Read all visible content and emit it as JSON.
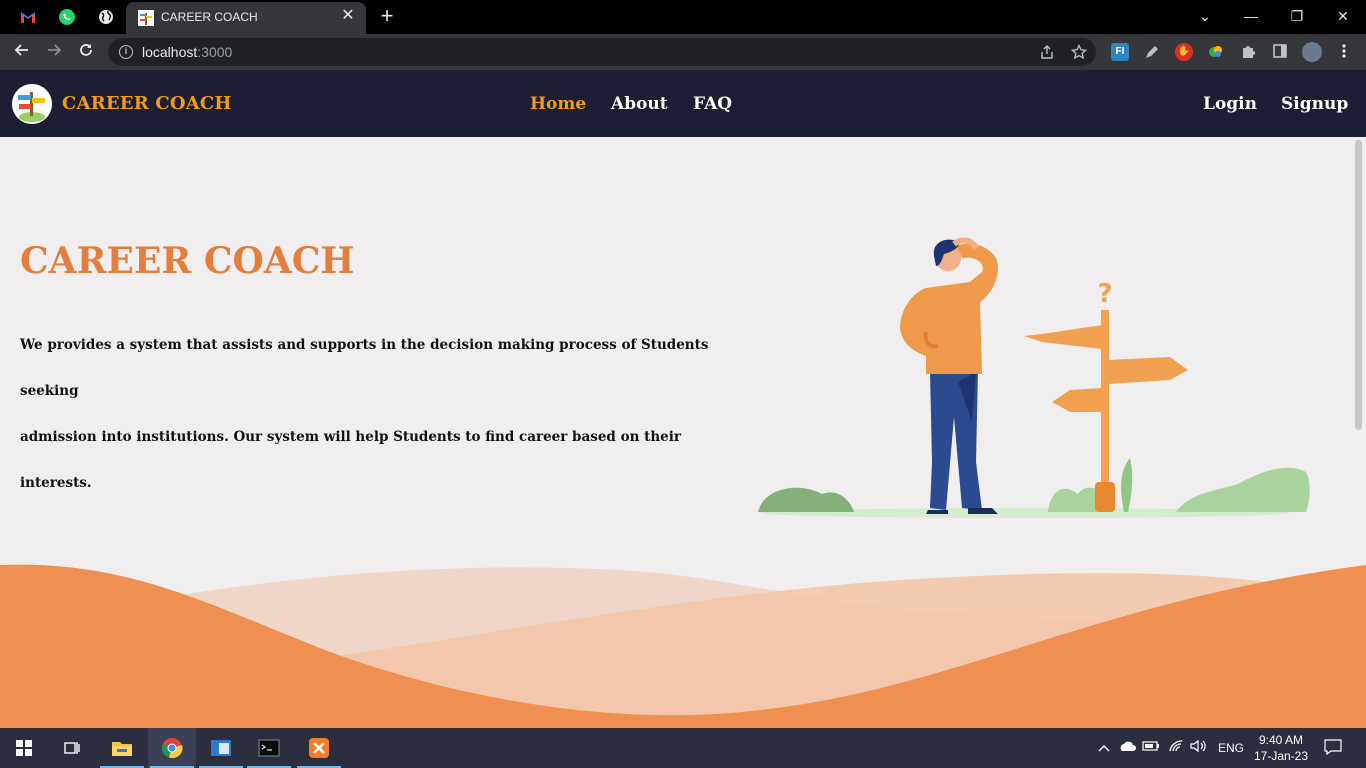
{
  "browser": {
    "tab_title": "CAREER COACH",
    "tab_close": "✕",
    "new_tab": "+",
    "url_host": "localhost",
    "url_port": ":3000",
    "window_controls": [
      "⌄",
      "—",
      "❐",
      "✕"
    ]
  },
  "navbar": {
    "brand": "CAREER COACH",
    "links": [
      {
        "label": "Home",
        "active": true
      },
      {
        "label": "About",
        "active": false
      },
      {
        "label": "FAQ",
        "active": false
      }
    ],
    "auth": {
      "login": "Login",
      "signup": "Signup"
    }
  },
  "hero": {
    "title": "CAREER COACH",
    "line1": "We provides a system that assists and supports in the decision making process of Students seeking",
    "line2": "admission into institutions. Our system will help Students to find career based on their interests.",
    "signpost_mark": "?"
  },
  "taskbar": {
    "lang": "ENG",
    "time": "9:40 AM",
    "date": "17-Jan-23"
  },
  "colors": {
    "accent": "#f39c12",
    "hero_title": "#e47e3c",
    "navbar_bg": "#1c1f33",
    "wave": "#f08f52"
  }
}
